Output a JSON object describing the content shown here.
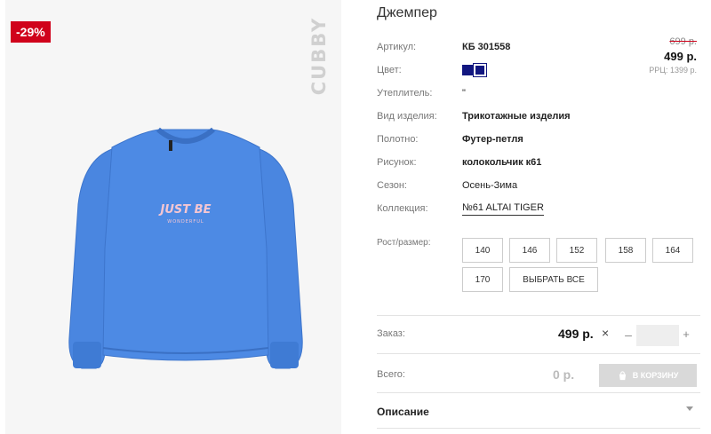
{
  "image": {
    "discount_badge": "-29%",
    "brand_vertical": "CUBBY",
    "garment_text_main": "JUST BE",
    "garment_text_sub": "WONDERFUL",
    "garment_color": "#4a86e0"
  },
  "product": {
    "title": "Джемпер",
    "specs": [
      {
        "label": "Артикул:",
        "value": "КБ 301558"
      },
      {
        "label": "Цвет:",
        "value": ""
      },
      {
        "label": "Утеплитель:",
        "value": "\""
      },
      {
        "label": "Вид изделия:",
        "value": "Трикотажные изделия"
      },
      {
        "label": "Полотно:",
        "value": "Футер-петля"
      },
      {
        "label": "Рисунок:",
        "value": "колокольчик к61"
      },
      {
        "label": "Сезон:",
        "value": "Осень-Зима"
      },
      {
        "label": "Коллекция:",
        "value": "№61 ALTAI TIGER"
      }
    ],
    "swatch_color": "#121780"
  },
  "price": {
    "old": "699 р.",
    "new": "499 р.",
    "rrp": "РРЦ: 1399 р."
  },
  "sizes": {
    "label": "Рост/размер:",
    "options": [
      "140",
      "146",
      "152",
      "158",
      "164",
      "170"
    ],
    "select_all": "ВЫБРАТЬ ВСЕ"
  },
  "order": {
    "label": "Заказ:",
    "price": "499 р.",
    "times": "×",
    "minus": "–",
    "qty_value": "",
    "plus": "+"
  },
  "total": {
    "label": "Всего:",
    "value": "0 р.",
    "cart_button": "В КОРЗИНУ"
  },
  "description": {
    "label": "Описание"
  }
}
